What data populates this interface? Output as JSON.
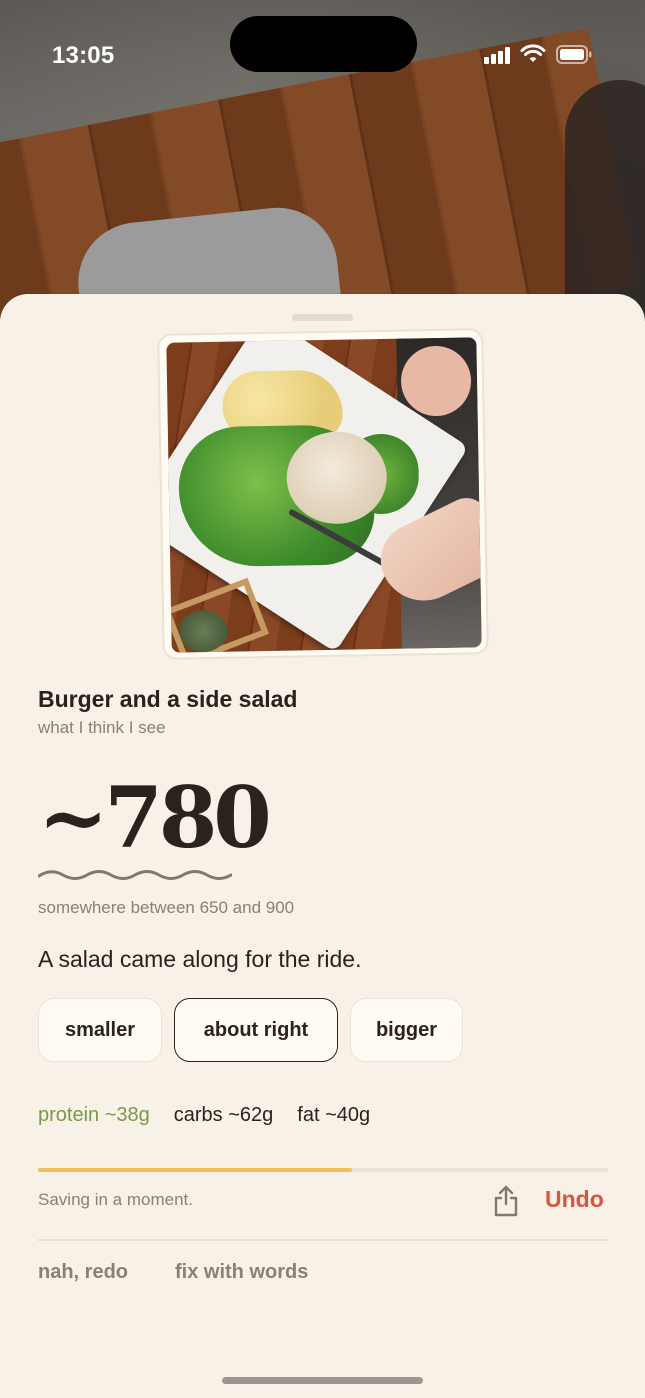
{
  "status_bar": {
    "time": "13:05"
  },
  "meal": {
    "title": "Burger and a side salad",
    "subtitle": "what I think I see",
    "calories": "~780",
    "range": "somewhere between 650 and 900",
    "comment": "A salad came along for the ride."
  },
  "portion_options": [
    {
      "label": "smaller",
      "selected": false
    },
    {
      "label": "about right",
      "selected": true
    },
    {
      "label": "bigger",
      "selected": false
    }
  ],
  "macros": {
    "protein": "protein ~38g",
    "carbs": "carbs ~62g",
    "fat": "fat ~40g"
  },
  "save": {
    "status": "Saving in a moment.",
    "progress": 0.55,
    "undo_label": "Undo"
  },
  "actions": {
    "redo": "nah, redo",
    "fix": "fix with words"
  },
  "colors": {
    "sheet_bg": "#f8f1e7",
    "accent_undo": "#d9553c",
    "protein": "#7a9a4a",
    "progress": "#ecc05a"
  },
  "icons": [
    "signal-icon",
    "wifi-icon",
    "battery-icon",
    "share-icon"
  ]
}
